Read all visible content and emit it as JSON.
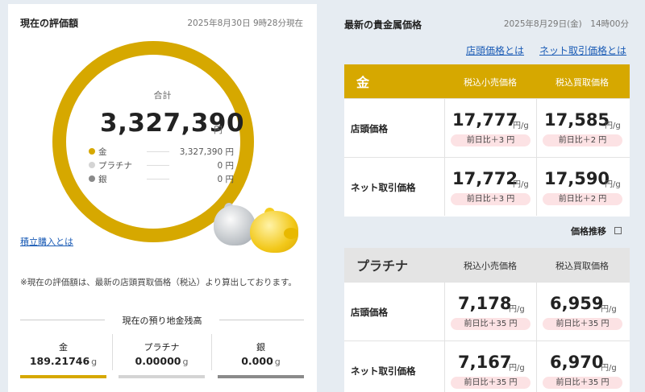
{
  "valuation": {
    "title": "現在の評価額",
    "datetime": "2025年8月30日 9時28分現在",
    "total_label": "合計",
    "total": "3,327,390",
    "unit": "円",
    "breakdown": [
      {
        "name": "金",
        "value": "3,327,390",
        "unit": "円",
        "color": "#d6a800"
      },
      {
        "name": "プラチナ",
        "value": "0",
        "unit": "円",
        "color": "#d4d4d4"
      },
      {
        "name": "銀",
        "value": "0",
        "unit": "円",
        "color": "#8a8a8a"
      }
    ],
    "link_label": "積立購入とは",
    "note": "※現在の評価額は、最新の店頭買取価格（税込）より算出しております。"
  },
  "balance": {
    "title": "現在の預り地金残高",
    "items": [
      {
        "name": "金",
        "value": "189.21746",
        "unit": "g",
        "color": "#d6a800"
      },
      {
        "name": "プラチナ",
        "value": "0.00000",
        "unit": "g",
        "color": "#d4d4d4"
      },
      {
        "name": "銀",
        "value": "0.000",
        "unit": "g",
        "color": "#8a8a8a"
      }
    ]
  },
  "prices": {
    "title": "最新の貴金属価格",
    "datetime": "2025年8月29日(金)　14時00分",
    "links": [
      "店頭価格とは",
      "ネット取引価格とは"
    ],
    "trend_label": "価格推移",
    "col_headers": [
      "税込小売価格",
      "税込買取価格"
    ],
    "row_labels": [
      "店頭価格",
      "ネット取引価格"
    ],
    "price_unit": "円/g",
    "metals": [
      {
        "name": "金",
        "header_bg": "#d6a800",
        "rows": [
          {
            "retail": "17,777",
            "retail_change": "前日比＋3 円",
            "buy": "17,585",
            "buy_change": "前日比＋2 円"
          },
          {
            "retail": "17,772",
            "retail_change": "前日比＋3 円",
            "buy": "17,590",
            "buy_change": "前日比＋2 円"
          }
        ]
      },
      {
        "name": "プラチナ",
        "header_bg": "#e4e4e4",
        "rows": [
          {
            "retail": "7,178",
            "retail_change": "前日比＋35 円",
            "buy": "6,959",
            "buy_change": "前日比＋35 円"
          },
          {
            "retail": "7,167",
            "retail_change": "前日比＋35 円",
            "buy": "6,970",
            "buy_change": "前日比＋35 円"
          }
        ]
      }
    ]
  }
}
